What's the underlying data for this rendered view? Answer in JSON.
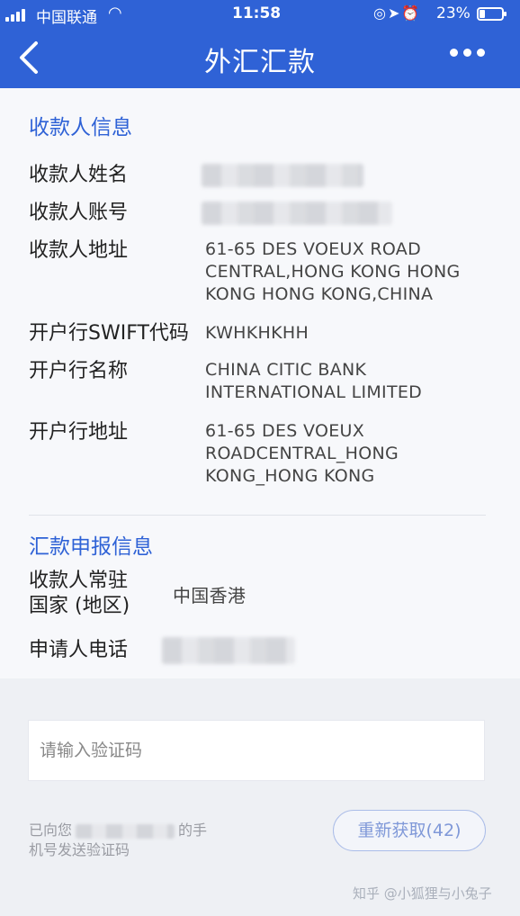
{
  "status_bar": {
    "carrier": "中国联通",
    "time": "11:58",
    "battery": "23%"
  },
  "nav": {
    "title": "外汇汇款"
  },
  "payee_section": {
    "title": "收款人信息",
    "name_label": "收款人姓名",
    "account_label": "收款人账号",
    "address_label": "收款人地址",
    "address_lines": [
      "61-65 DES VOEUX ROAD",
      "CENTRAL,HONG KONG HONG",
      "KONG HONG KONG,CHINA"
    ],
    "swift_label": "开户行SWIFT代码",
    "swift_value": "KWHKHKHH",
    "bank_name_label": "开户行名称",
    "bank_name_lines": [
      "CHINA CITIC BANK",
      "INTERNATIONAL LIMITED"
    ],
    "bank_address_label": "开户行地址",
    "bank_address_lines": [
      "61-65 DES VOEUX",
      "ROADCENTRAL_HONG",
      "KONG_HONG KONG"
    ]
  },
  "report_section": {
    "title": "汇款申报信息",
    "country_label_line1": "收款人常驻",
    "country_label_line2": "国家 (地区)",
    "country_value": "中国香港",
    "phone_label": "申请人电话"
  },
  "verification": {
    "placeholder": "请输入验证码",
    "sent_prefix": "已向您",
    "sent_suffix": "的手",
    "sent_line2": "机号发送验证码",
    "resend_label": "重新获取(42)"
  },
  "watermark": "知乎 @小狐狸与小兔子"
}
